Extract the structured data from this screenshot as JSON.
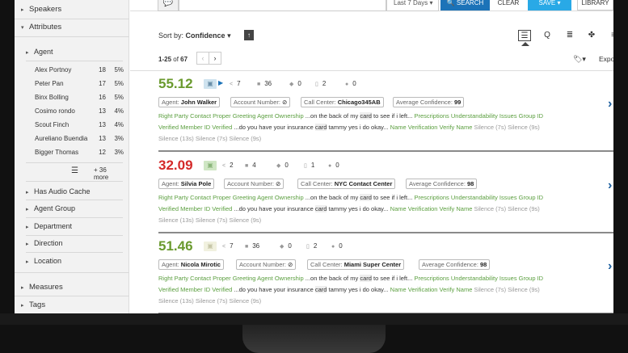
{
  "search": {
    "date_range": "Last 7 Days",
    "search_label": "SEARCH",
    "clear_label": "CLEAR",
    "save_label": "SAVE",
    "library_label": "LIBRARY"
  },
  "sidebar": {
    "speakers": "Speakers",
    "attributes": "Attributes",
    "agent": "Agent",
    "agents": [
      {
        "name": "Alex Portnoy",
        "count": "18",
        "pct": "5%"
      },
      {
        "name": "Peter Pan",
        "count": "17",
        "pct": "5%"
      },
      {
        "name": "Binx Bolling",
        "count": "16",
        "pct": "5%"
      },
      {
        "name": "Cosimo rondo",
        "count": "13",
        "pct": "4%"
      },
      {
        "name": "Scout Finch",
        "count": "13",
        "pct": "4%"
      },
      {
        "name": "Aureliano Buendia",
        "count": "13",
        "pct": "3%"
      },
      {
        "name": "Bigger Thomas",
        "count": "12",
        "pct": "3%"
      }
    ],
    "more": "+ 36 more",
    "sub_items": [
      "Has Audio Cache",
      "Agent Group",
      "Department",
      "Direction",
      "Location"
    ],
    "measures": "Measures",
    "tags": "Tags"
  },
  "sort": {
    "label": "Sort by:",
    "value": "Confidence"
  },
  "paging": {
    "range": "1-25",
    "of": "of",
    "total": "67"
  },
  "export_label": "Export",
  "results": [
    {
      "score": "55.12",
      "score_color": "#6a9a2e",
      "stats": [
        "7",
        "36",
        "0",
        "2",
        "0"
      ],
      "agent_label": "Agent:",
      "agent": "John Walker",
      "account_label": "Account Number:",
      "call_center_label": "Call Center:",
      "call_center": "Chicago345AB",
      "avg_label": "Average Confidence:",
      "avg": "99",
      "line1_a": "Right Party Contact Proper Greeting Agent Ownership",
      "line1_b": " ...on the back of my ",
      "line1_c": "card",
      "line1_d": " to see if i left...",
      "line1_e": "  Prescriptions Understandability Issues Group ID",
      "line2_a": "Verified Member ID Verified",
      "line2_b": " ...do you have your insurance ",
      "line2_c": "card",
      "line2_d": " tammy yes i do okay...",
      "line2_e": "  Name Verification Verify Name",
      "line2_f": "  Silence (7s)  Silence (9s)",
      "line3": "Silence (13s)  Silence (7s)  Silence (9s)"
    },
    {
      "score": "32.09",
      "score_color": "#d42a2a",
      "stats": [
        "2",
        "4",
        "0",
        "1",
        "0"
      ],
      "agent_label": "Agent:",
      "agent": "Silvia Pole",
      "account_label": "Account Number:",
      "call_center_label": "Call Center:",
      "call_center": "NYC Contact Center",
      "avg_label": "Average Confidence:",
      "avg": "98",
      "line1_a": "Right Party Contact Proper Greeting Agent Ownership",
      "line1_b": " ...on the back of my ",
      "line1_c": "card",
      "line1_d": " to see if i left...",
      "line1_e": "  Prescriptions Understandability Issues Group ID",
      "line2_a": "Verified Member ID Verified",
      "line2_b": " ...do you have your insurance ",
      "line2_c": "card",
      "line2_d": " tammy yes i do okay...",
      "line2_e": "  Name Verification Verify Name",
      "line2_f": "  Silence (7s)  Silence (9s)",
      "line3": "Silence (13s)  Silence (7s)  Silence (9s)"
    },
    {
      "score": "51.46",
      "score_color": "#6a9a2e",
      "stats": [
        "7",
        "36",
        "0",
        "2",
        "0"
      ],
      "agent_label": "Agent:",
      "agent": "Nicola Mirotic",
      "account_label": "Account Number:",
      "call_center_label": "Call Center:",
      "call_center": "Miami Super Center",
      "avg_label": "Average Confidence:",
      "avg": "98",
      "line1_a": "Right Party Contact Proper Greeting Agent Ownership",
      "line1_b": " ...on the back of my ",
      "line1_c": "card",
      "line1_d": " to see if i left...",
      "line1_e": "  Prescriptions Understandability Issues Group ID",
      "line2_a": "Verified Member ID Verified",
      "line2_b": " ...do you have your insurance ",
      "line2_c": "card",
      "line2_d": " tammy yes i do okay...",
      "line2_e": "  Name Verification Verify Name",
      "line2_f": "  Silence (7s)  Silence (9s)",
      "line3": "Silence (13s)  Silence (7s)  Silence (9s)"
    }
  ]
}
